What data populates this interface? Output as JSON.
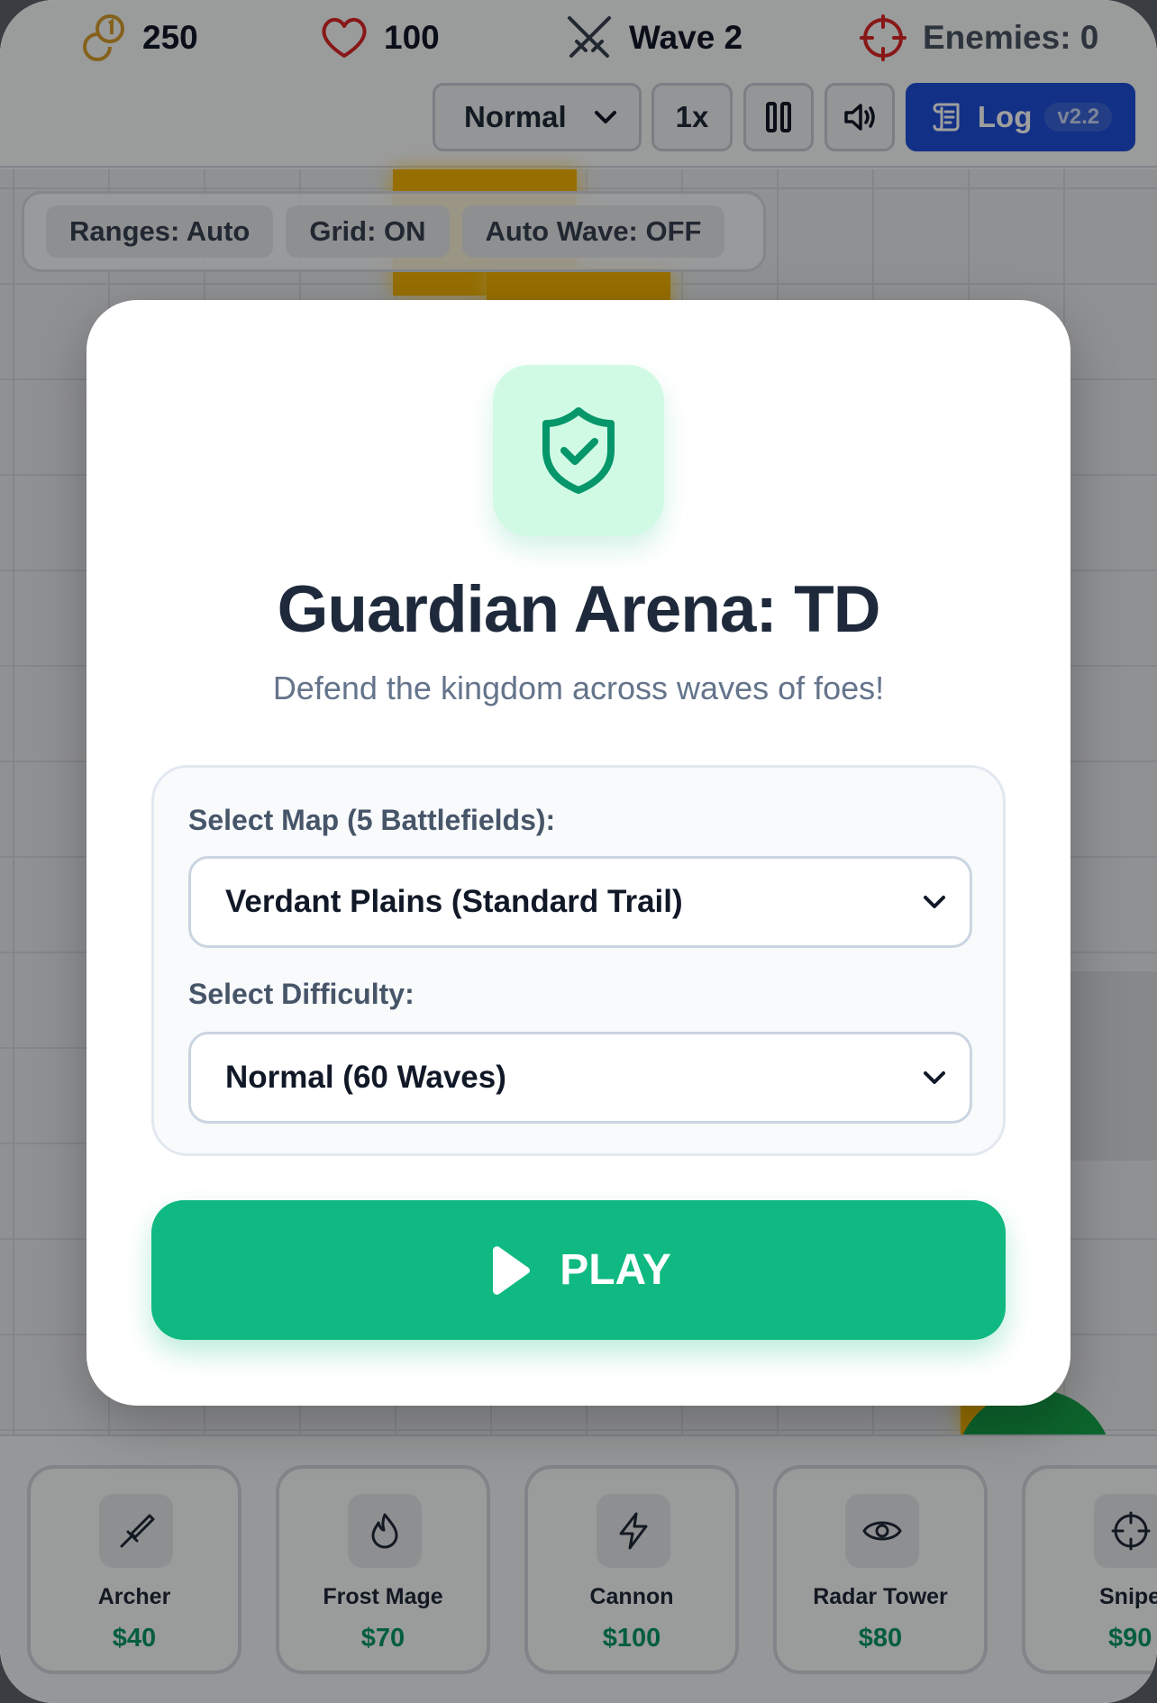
{
  "hud": {
    "gold": "250",
    "lives": "100",
    "wave": "Wave 2",
    "enemies": "Enemies: 0"
  },
  "controls": {
    "difficulty": "Normal",
    "speed": "1x",
    "log_label": "Log",
    "version": "v2.2"
  },
  "toggles": [
    {
      "label": "Ranges: Auto"
    },
    {
      "label": "Grid: ON"
    },
    {
      "label": "Auto Wave: OFF"
    }
  ],
  "shop": {
    "towers": [
      {
        "name": "Archer",
        "price": "$40",
        "icon": "sword-icon"
      },
      {
        "name": "Frost Mage",
        "price": "$70",
        "icon": "flame-icon"
      },
      {
        "name": "Cannon",
        "price": "$100",
        "icon": "lightning-icon"
      },
      {
        "name": "Radar Tower",
        "price": "$80",
        "icon": "eye-icon"
      },
      {
        "name": "Snipe",
        "price": "$90",
        "icon": "crosshair-icon"
      }
    ]
  },
  "modal": {
    "icon": "shield-check-icon",
    "title": "Guardian Arena: TD",
    "subtitle": "Defend the kingdom across waves of foes!",
    "map_label": "Select Map (5 Battlefields):",
    "map_value": "Verdant Plains (Standard Trail)",
    "difficulty_label": "Select Difficulty:",
    "difficulty_value": "Normal (60 Waves)",
    "play_label": "PLAY"
  },
  "colors": {
    "accent": "#10b981",
    "log_button": "#1d4ed8",
    "price": "#059669",
    "path": "#f4b400",
    "gold": "#d69e2e",
    "heart": "#dc2626"
  }
}
